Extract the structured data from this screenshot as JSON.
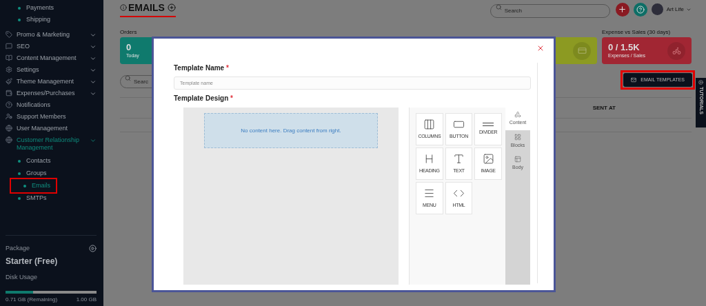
{
  "sidebar": {
    "top_subitems": [
      {
        "label": "Payments",
        "selected": false
      },
      {
        "label": "Shipping",
        "selected": false
      }
    ],
    "items": [
      {
        "label": "Promo & Marketing",
        "expandable": true,
        "selected": false
      },
      {
        "label": "SEO",
        "expandable": true,
        "selected": false
      },
      {
        "label": "Content Management",
        "expandable": true,
        "selected": false
      },
      {
        "label": "Settings",
        "expandable": true,
        "selected": false
      },
      {
        "label": "Theme Management",
        "expandable": true,
        "selected": false
      },
      {
        "label": "Expenses/Purchases",
        "expandable": true,
        "selected": false
      },
      {
        "label": "Notifications",
        "expandable": false,
        "selected": false
      },
      {
        "label": "Support Members",
        "expandable": false,
        "selected": false
      },
      {
        "label": "User Management",
        "expandable": false,
        "selected": false
      },
      {
        "label": "Customer Relationship Management",
        "expandable": true,
        "selected": true,
        "children": [
          {
            "label": "Contacts",
            "selected": false
          },
          {
            "label": "Groups",
            "selected": false
          },
          {
            "label": "Emails",
            "selected": true
          },
          {
            "label": "SMTPs",
            "selected": false
          }
        ]
      }
    ],
    "package": {
      "label": "Package",
      "plan": "Starter (Free)",
      "disk_label": "Disk Usage",
      "level": 0.3,
      "remaining": "0.71 GB (Remaining)",
      "total": "1.00 GB"
    }
  },
  "header": {
    "title": "EMAILS",
    "search": {
      "placeholder": "Search"
    },
    "user": "Art Life"
  },
  "stat_cards": [
    {
      "label": "Orders",
      "value": "0",
      "sub": "Today",
      "color": "#0f7a6d"
    },
    {
      "color": "#8c9a22"
    },
    {
      "label": "Expense vs Sales (30 days)",
      "value": "0 / 1.5K",
      "sub": "Expenses / Sales",
      "color": "#a12633"
    }
  ],
  "table": {
    "search": {
      "placeholder": "Searc"
    },
    "columns": [
      "SENT AT"
    ]
  },
  "email_templates_button": "EMAIL TEMPLATES",
  "tutorials_tab": "TUTORIALS",
  "modal": {
    "name_label": "Template Name",
    "name_placeholder": "Template name",
    "design_label": "Template Design",
    "required_mark": "*",
    "empty_message": "No content here. Drag content from right.",
    "tools": [
      {
        "kind": "columns",
        "label": "COLUMNS"
      },
      {
        "kind": "button",
        "label": "BUTTON"
      },
      {
        "kind": "divider",
        "label": "DIVIDER"
      },
      {
        "kind": "heading",
        "label": "HEADING"
      },
      {
        "kind": "text",
        "label": "TEXT"
      },
      {
        "kind": "image",
        "label": "IMAGE"
      },
      {
        "kind": "menu",
        "label": "MENU"
      },
      {
        "kind": "html",
        "label": "HTML"
      }
    ],
    "tabs": [
      {
        "kind": "content",
        "label": "Content",
        "selected": true
      },
      {
        "kind": "blocks",
        "label": "Blocks",
        "selected": false
      },
      {
        "kind": "body",
        "label": "Body",
        "selected": false
      }
    ]
  }
}
